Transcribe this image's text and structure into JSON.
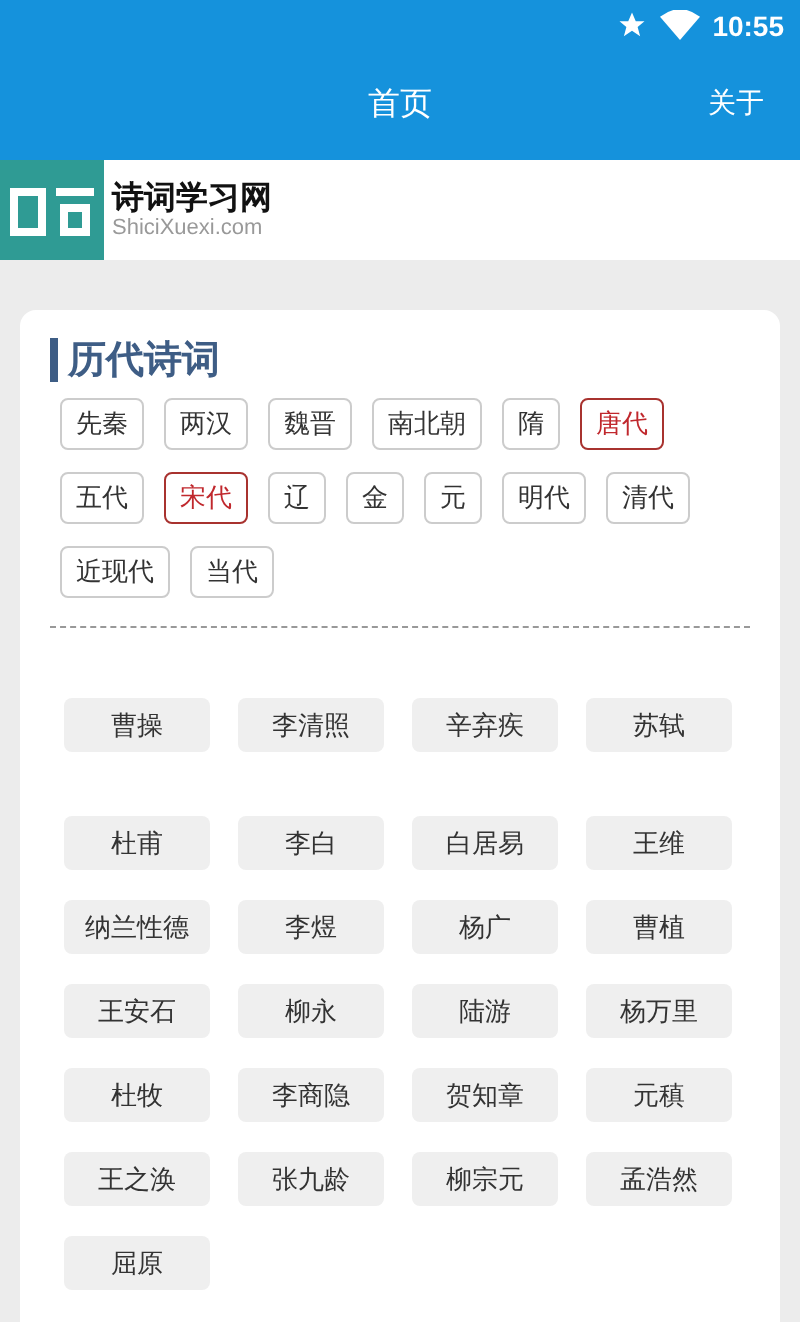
{
  "status_bar": {
    "time": "10:55"
  },
  "app_bar": {
    "title": "首页",
    "action": "关于"
  },
  "banner": {
    "site_name": "诗词学习网",
    "domain": "ShiciXuexi.com"
  },
  "section": {
    "title": "历代诗词",
    "dynasties": [
      {
        "label": "先秦",
        "selected": false
      },
      {
        "label": "两汉",
        "selected": false
      },
      {
        "label": "魏晋",
        "selected": false
      },
      {
        "label": "南北朝",
        "selected": false
      },
      {
        "label": "隋",
        "selected": false
      },
      {
        "label": "唐代",
        "selected": true
      },
      {
        "label": "五代",
        "selected": false
      },
      {
        "label": "宋代",
        "selected": true
      },
      {
        "label": "辽",
        "selected": false
      },
      {
        "label": "金",
        "selected": false
      },
      {
        "label": "元",
        "selected": false
      },
      {
        "label": "明代",
        "selected": false
      },
      {
        "label": "清代",
        "selected": false
      },
      {
        "label": "近现代",
        "selected": false
      },
      {
        "label": "当代",
        "selected": false
      }
    ]
  },
  "poet_groups": [
    [
      "曹操",
      "李清照",
      "辛弃疾",
      "苏轼"
    ],
    [
      "杜甫",
      "李白",
      "白居易",
      "王维",
      "纳兰性德",
      "李煜",
      "杨广",
      "曹植",
      "王安石",
      "柳永",
      "陆游",
      "杨万里",
      "杜牧",
      "李商隐",
      "贺知章",
      "元稹",
      "王之涣",
      "张九龄",
      "柳宗元",
      "孟浩然",
      "屈原"
    ]
  ]
}
